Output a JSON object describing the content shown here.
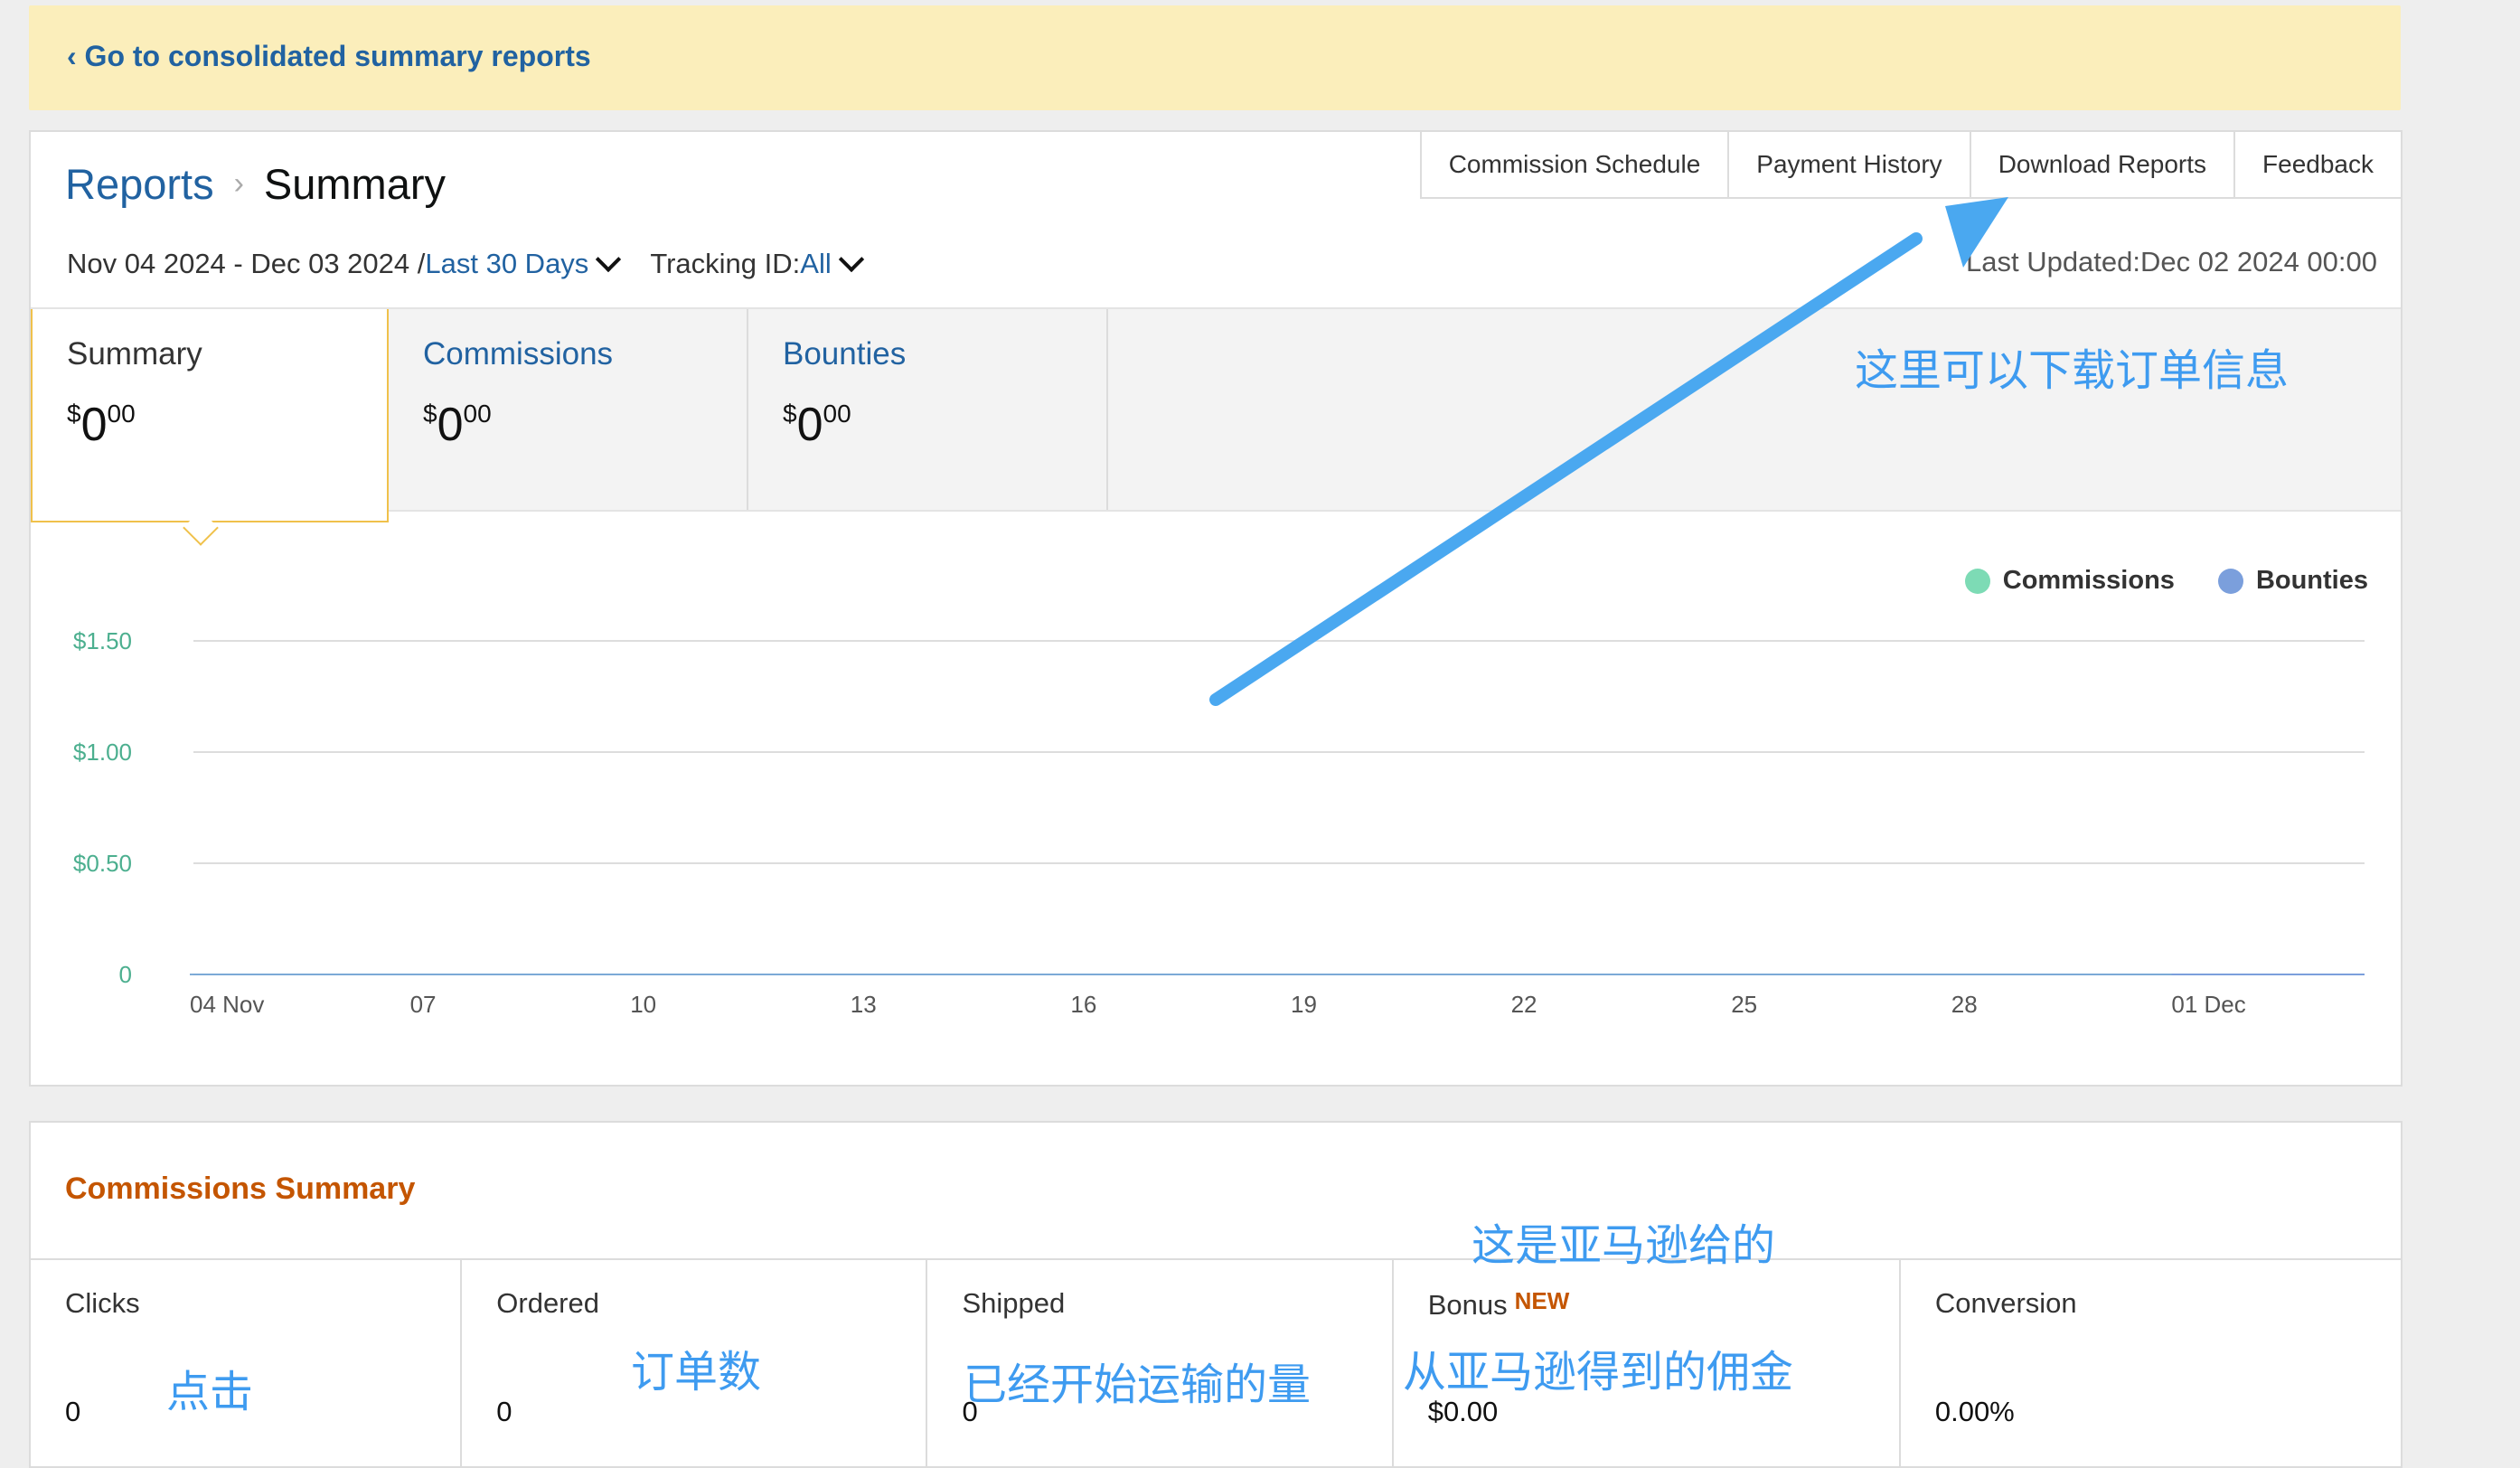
{
  "banner": {
    "link_text": "‹ Go to consolidated summary reports"
  },
  "breadcrumb": {
    "parent": "Reports",
    "separator": "›",
    "current": "Summary"
  },
  "toolbar": [
    "Commission Schedule",
    "Payment History",
    "Download Reports",
    "Feedback"
  ],
  "filters": {
    "date_range": "Nov 04 2024 - Dec 03 2024 /",
    "period": "Last 30 Days",
    "tracking_label": "Tracking ID:",
    "tracking_value": "All"
  },
  "last_updated": "Last Updated:Dec 02 2024 00:00",
  "tabs": [
    {
      "title": "Summary",
      "currency": "$",
      "whole": "0",
      "cents": "00",
      "active": true
    },
    {
      "title": "Commissions",
      "currency": "$",
      "whole": "0",
      "cents": "00",
      "active": false
    },
    {
      "title": "Bounties",
      "currency": "$",
      "whole": "0",
      "cents": "00",
      "active": false
    }
  ],
  "legend": [
    {
      "name": "Commissions",
      "color": "#7ddbb5"
    },
    {
      "name": "Bounties",
      "color": "#7b9fdc"
    }
  ],
  "chart_data": {
    "type": "line",
    "x": [
      "04 Nov",
      "07",
      "10",
      "13",
      "16",
      "19",
      "22",
      "25",
      "28",
      "01 Dec"
    ],
    "x_tick_step_days": 3,
    "series": [
      {
        "name": "Commissions",
        "values": [
          0,
          0,
          0,
          0,
          0,
          0,
          0,
          0,
          0,
          0
        ]
      },
      {
        "name": "Bounties",
        "values": [
          0,
          0,
          0,
          0,
          0,
          0,
          0,
          0,
          0,
          0
        ]
      }
    ],
    "yticks": [
      "0",
      "$0.50",
      "$1.00",
      "$1.50"
    ],
    "ylim": [
      0,
      1.5
    ],
    "grid": true,
    "legend_position": "top-right",
    "axis_color": "#4caf8f",
    "grid_color": "#dddddd",
    "baseline_color": "#7b9fdc"
  },
  "commissions_summary": {
    "title": "Commissions Summary",
    "metrics": [
      {
        "label": "Clicks",
        "value": "0"
      },
      {
        "label": "Ordered",
        "value": "0"
      },
      {
        "label": "Shipped",
        "value": "0"
      },
      {
        "label": "Bonus",
        "badge": "NEW",
        "value": "$0.00"
      },
      {
        "label": "Conversion",
        "value": "0.00%"
      }
    ]
  },
  "annotations": {
    "download_note": "这里可以下载订单信息",
    "amazon_gives": "这是亚马逊给的",
    "clicks_note": "点击",
    "orders_note": "订单数",
    "shipped_note": "已经开始运输的量",
    "bonus_note": "从亚马逊得到的佣金",
    "color": "#3e9bf0"
  }
}
